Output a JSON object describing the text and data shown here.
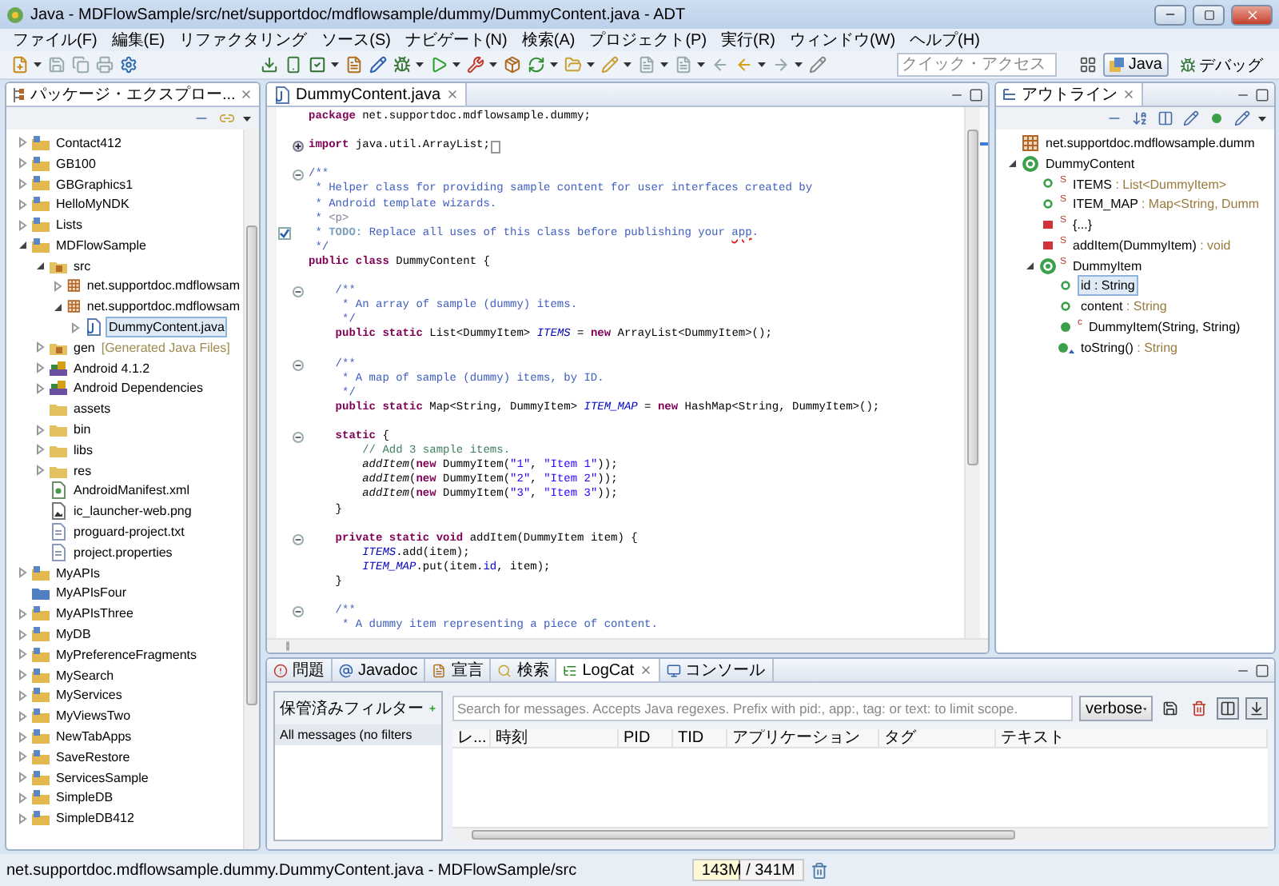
{
  "window": {
    "title": "Java - MDFlowSample/src/net/supportdoc/mdflowsample/dummy/DummyContent.java - ADT"
  },
  "menu": [
    "ファイル(F)",
    "編集(E)",
    "リファクタリング",
    "ソース(S)",
    "ナビゲート(N)",
    "検索(A)",
    "プロジェクト(P)",
    "実行(R)",
    "ウィンドウ(W)",
    "ヘルプ(H)"
  ],
  "toolbar": {
    "quick_access": {
      "placeholder": "クイック・アクセス"
    },
    "perspectives": [
      {
        "label": "Java",
        "kind": "java",
        "selected": true
      },
      {
        "label": "デバッグ",
        "kind": "debug",
        "selected": false
      }
    ]
  },
  "package_explorer": {
    "title": "パッケージ・エクスプロー...",
    "tree": [
      {
        "label": "Contact412",
        "kind": "project",
        "expanded": false,
        "selected": false
      },
      {
        "label": "GB100",
        "kind": "project",
        "expanded": false,
        "selected": false
      },
      {
        "label": "GBGraphics1",
        "kind": "project",
        "expanded": false,
        "selected": false
      },
      {
        "label": "HelloMyNDK",
        "kind": "project",
        "expanded": false,
        "selected": false
      },
      {
        "label": "Lists",
        "kind": "project",
        "expanded": false,
        "selected": false
      },
      {
        "label": "MDFlowSample",
        "kind": "project",
        "expanded": true,
        "selected": false,
        "children": [
          {
            "label": "src",
            "kind": "source-folder",
            "expanded": true,
            "selected": false,
            "children": [
              {
                "label": "net.supportdoc.mdflowsam",
                "kind": "package",
                "expanded": false,
                "selected": false
              },
              {
                "label": "net.supportdoc.mdflowsam",
                "kind": "package",
                "expanded": true,
                "selected": false,
                "children": [
                  {
                    "label": "DummyContent.java",
                    "kind": "java-file",
                    "expanded": false,
                    "selected": true
                  }
                ]
              }
            ]
          },
          {
            "label": "gen",
            "note": "[Generated Java Files]",
            "kind": "source-folder",
            "expanded": false,
            "selected": false
          },
          {
            "label": "Android 4.1.2",
            "kind": "library",
            "expanded": false,
            "selected": false
          },
          {
            "label": "Android Dependencies",
            "kind": "library",
            "expanded": false,
            "selected": false
          },
          {
            "label": "assets",
            "kind": "folder",
            "selected": false
          },
          {
            "label": "bin",
            "kind": "folder",
            "expanded": false,
            "selected": false
          },
          {
            "label": "libs",
            "kind": "folder",
            "expanded": false,
            "selected": false
          },
          {
            "label": "res",
            "kind": "folder",
            "expanded": false,
            "selected": false
          },
          {
            "label": "AndroidManifest.xml",
            "kind": "xml-file",
            "selected": false
          },
          {
            "label": "ic_launcher-web.png",
            "kind": "image-file",
            "selected": false
          },
          {
            "label": "proguard-project.txt",
            "kind": "text-file",
            "selected": false
          },
          {
            "label": "project.properties",
            "kind": "text-file",
            "selected": false
          }
        ]
      },
      {
        "label": "MyAPIs",
        "kind": "project",
        "expanded": false,
        "selected": false
      },
      {
        "label": "MyAPIsFour",
        "kind": "closed-project",
        "selected": false
      },
      {
        "label": "MyAPIsThree",
        "kind": "project",
        "expanded": false,
        "selected": false
      },
      {
        "label": "MyDB",
        "kind": "project",
        "expanded": false,
        "selected": false
      },
      {
        "label": "MyPreferenceFragments",
        "kind": "project",
        "expanded": false,
        "selected": false
      },
      {
        "label": "MySearch",
        "kind": "project",
        "expanded": false,
        "selected": false
      },
      {
        "label": "MyServices",
        "kind": "project",
        "expanded": false,
        "selected": false
      },
      {
        "label": "MyViewsTwo",
        "kind": "project",
        "expanded": false,
        "selected": false
      },
      {
        "label": "NewTabApps",
        "kind": "project",
        "expanded": false,
        "selected": false
      },
      {
        "label": "SaveRestore",
        "kind": "project",
        "expanded": false,
        "selected": false
      },
      {
        "label": "ServicesSample",
        "kind": "project",
        "expanded": false,
        "selected": false
      },
      {
        "label": "SimpleDB",
        "kind": "project",
        "expanded": false,
        "selected": false
      },
      {
        "label": "SimpleDB412",
        "kind": "project",
        "expanded": false,
        "selected": false
      }
    ]
  },
  "editor": {
    "tab": "DummyContent.java",
    "lines": [
      {
        "kind": "code",
        "segments": [
          {
            "kind": "keyword",
            "text": "package"
          },
          {
            "kind": "plain",
            "text": " net.supportdoc.mdflowsample.dummy;"
          }
        ]
      },
      {
        "kind": "blank"
      },
      {
        "kind": "folded",
        "segments": [
          {
            "kind": "keyword",
            "text": "import"
          },
          {
            "kind": "plain",
            "text": " java.util.ArrayList;"
          }
        ]
      },
      {
        "kind": "blank"
      },
      {
        "kind": "fold-start",
        "segments": [
          {
            "kind": "doc",
            "text": "/**"
          }
        ]
      },
      {
        "kind": "code",
        "segments": [
          {
            "kind": "doc",
            "text": " * Helper class for providing sample content for user interfaces created by"
          }
        ]
      },
      {
        "kind": "code",
        "segments": [
          {
            "kind": "doc",
            "text": " * Android template wizards."
          }
        ]
      },
      {
        "kind": "code",
        "segments": [
          {
            "kind": "doc",
            "text": " * "
          },
          {
            "kind": "doc-tag",
            "text": "<p>"
          }
        ]
      },
      {
        "kind": "task",
        "segments": [
          {
            "kind": "doc",
            "text": " * "
          },
          {
            "kind": "task-tag",
            "text": "TODO:"
          },
          {
            "kind": "doc",
            "text": " Replace all uses of this class before publishing your "
          },
          {
            "kind": "misspelled",
            "text": "app"
          },
          {
            "kind": "doc",
            "text": "."
          }
        ]
      },
      {
        "kind": "code",
        "segments": [
          {
            "kind": "doc",
            "text": " */"
          }
        ]
      },
      {
        "kind": "code",
        "segments": [
          {
            "kind": "keyword",
            "text": "public class"
          },
          {
            "kind": "plain",
            "text": " DummyContent {"
          }
        ]
      },
      {
        "kind": "blank"
      },
      {
        "kind": "fold-start",
        "segments": [
          {
            "kind": "doc",
            "text": "    /**"
          }
        ]
      },
      {
        "kind": "code",
        "segments": [
          {
            "kind": "doc",
            "text": "     * An array of sample (dummy) items."
          }
        ]
      },
      {
        "kind": "code",
        "segments": [
          {
            "kind": "doc",
            "text": "     */"
          }
        ]
      },
      {
        "kind": "code",
        "segments": [
          {
            "kind": "keyword",
            "text": "    public static"
          },
          {
            "kind": "plain",
            "text": " List<DummyItem> "
          },
          {
            "kind": "field",
            "text": "ITEMS"
          },
          {
            "kind": "plain",
            "text": " = "
          },
          {
            "kind": "keyword",
            "text": "new"
          },
          {
            "kind": "plain",
            "text": " ArrayList<DummyItem>();"
          }
        ]
      },
      {
        "kind": "blank"
      },
      {
        "kind": "fold-start",
        "segments": [
          {
            "kind": "doc",
            "text": "    /**"
          }
        ]
      },
      {
        "kind": "code",
        "segments": [
          {
            "kind": "doc",
            "text": "     * A map of sample (dummy) items, by ID."
          }
        ]
      },
      {
        "kind": "code",
        "segments": [
          {
            "kind": "doc",
            "text": "     */"
          }
        ]
      },
      {
        "kind": "code",
        "segments": [
          {
            "kind": "keyword",
            "text": "    public static"
          },
          {
            "kind": "plain",
            "text": " Map<String, DummyItem> "
          },
          {
            "kind": "field",
            "text": "ITEM_MAP"
          },
          {
            "kind": "plain",
            "text": " = "
          },
          {
            "kind": "keyword",
            "text": "new"
          },
          {
            "kind": "plain",
            "text": " HashMap<String, DummyItem>();"
          }
        ]
      },
      {
        "kind": "blank"
      },
      {
        "kind": "fold-start",
        "segments": [
          {
            "kind": "keyword",
            "text": "    static"
          },
          {
            "kind": "plain",
            "text": " {"
          }
        ]
      },
      {
        "kind": "code",
        "segments": [
          {
            "kind": "comment",
            "text": "        // Add 3 sample items."
          }
        ]
      },
      {
        "kind": "code",
        "segments": [
          {
            "kind": "static-call",
            "text": "        addItem"
          },
          {
            "kind": "plain",
            "text": "("
          },
          {
            "kind": "keyword",
            "text": "new"
          },
          {
            "kind": "plain",
            "text": " DummyItem("
          },
          {
            "kind": "string",
            "text": "\"1\""
          },
          {
            "kind": "plain",
            "text": ", "
          },
          {
            "kind": "string",
            "text": "\"Item 1\""
          },
          {
            "kind": "plain",
            "text": "));"
          }
        ]
      },
      {
        "kind": "code",
        "segments": [
          {
            "kind": "static-call",
            "text": "        addItem"
          },
          {
            "kind": "plain",
            "text": "("
          },
          {
            "kind": "keyword",
            "text": "new"
          },
          {
            "kind": "plain",
            "text": " DummyItem("
          },
          {
            "kind": "string",
            "text": "\"2\""
          },
          {
            "kind": "plain",
            "text": ", "
          },
          {
            "kind": "string",
            "text": "\"Item 2\""
          },
          {
            "kind": "plain",
            "text": "));"
          }
        ]
      },
      {
        "kind": "code",
        "segments": [
          {
            "kind": "static-call",
            "text": "        addItem"
          },
          {
            "kind": "plain",
            "text": "("
          },
          {
            "kind": "keyword",
            "text": "new"
          },
          {
            "kind": "plain",
            "text": " DummyItem("
          },
          {
            "kind": "string",
            "text": "\"3\""
          },
          {
            "kind": "plain",
            "text": ", "
          },
          {
            "kind": "string",
            "text": "\"Item 3\""
          },
          {
            "kind": "plain",
            "text": "));"
          }
        ]
      },
      {
        "kind": "code",
        "segments": [
          {
            "kind": "plain",
            "text": "    }"
          }
        ]
      },
      {
        "kind": "blank"
      },
      {
        "kind": "fold-start",
        "segments": [
          {
            "kind": "keyword",
            "text": "    private static void"
          },
          {
            "kind": "plain",
            "text": " addItem(DummyItem item) {"
          }
        ]
      },
      {
        "kind": "code",
        "segments": [
          {
            "kind": "field",
            "text": "        ITEMS"
          },
          {
            "kind": "plain",
            "text": ".add(item);"
          }
        ]
      },
      {
        "kind": "code",
        "segments": [
          {
            "kind": "field",
            "text": "        ITEM_MAP"
          },
          {
            "kind": "plain",
            "text": ".put(item."
          },
          {
            "kind": "member",
            "text": "id"
          },
          {
            "kind": "plain",
            "text": ", item);"
          }
        ]
      },
      {
        "kind": "code",
        "segments": [
          {
            "kind": "plain",
            "text": "    }"
          }
        ]
      },
      {
        "kind": "blank"
      },
      {
        "kind": "fold-start",
        "segments": [
          {
            "kind": "doc",
            "text": "    /**"
          }
        ]
      },
      {
        "kind": "code",
        "segments": [
          {
            "kind": "doc",
            "text": "     * A dummy item representing a piece of content."
          }
        ]
      }
    ]
  },
  "outline": {
    "title": "アウトライン",
    "tree": [
      {
        "label": "net.supportdoc.mdflowsample.dumm",
        "kind": "package",
        "selected": false
      },
      {
        "label": "DummyContent",
        "kind": "class",
        "expanded": true,
        "selected": false,
        "children": [
          {
            "label": "ITEMS",
            "detail": " : List<DummyItem>",
            "kind": "field",
            "modifier": "S",
            "selected": false
          },
          {
            "label": "ITEM_MAP",
            "detail": " : Map<String, Dumm",
            "kind": "field",
            "modifier": "S",
            "selected": false
          },
          {
            "label": "{...}",
            "kind": "private",
            "modifier": "S",
            "selected": false
          },
          {
            "label": "addItem(DummyItem)",
            "detail": " : void",
            "kind": "private",
            "modifier": "S",
            "selected": false
          },
          {
            "label": "DummyItem",
            "kind": "class",
            "modifier": "S",
            "expanded": true,
            "selected": false,
            "children": [
              {
                "label": "id",
                "detail": " : String",
                "kind": "field",
                "selected": true
              },
              {
                "label": "content",
                "detail": " : String",
                "kind": "field",
                "selected": false
              },
              {
                "label": "DummyItem(String, String)",
                "kind": "method",
                "modifier": "c",
                "selected": false
              },
              {
                "label": "toString()",
                "detail": " : String",
                "kind": "method-override",
                "selected": false
              }
            ]
          }
        ]
      }
    ]
  },
  "bottom_panel": {
    "tabs": [
      {
        "label": "問題",
        "kind": "problems",
        "selected": false
      },
      {
        "label": "Javadoc",
        "kind": "javadoc",
        "selected": false
      },
      {
        "label": "宣言",
        "kind": "declaration",
        "selected": false
      },
      {
        "label": "検索",
        "kind": "search",
        "selected": false
      },
      {
        "label": "LogCat",
        "kind": "logcat",
        "selected": true
      },
      {
        "label": "コンソール",
        "kind": "console",
        "selected": false
      }
    ],
    "logcat": {
      "filters_title": "保管済みフィルター",
      "filters": [
        {
          "label": "All messages (no filters",
          "selected": true
        }
      ],
      "search": {
        "placeholder": "Search for messages. Accepts Java regexes. Prefix with pid:, app:, tag: or text: to limit scope."
      },
      "log_level": "verbose",
      "columns": [
        "レ...",
        "時刻",
        "PID",
        "TID",
        "アプリケーション",
        "タグ",
        "テキスト"
      ]
    }
  },
  "status_bar": {
    "path": "net.supportdoc.mdflowsample.dummy.DummyContent.java - MDFlowSample/src",
    "memory": {
      "reading": "143M / 341M",
      "level": 0.42
    }
  }
}
